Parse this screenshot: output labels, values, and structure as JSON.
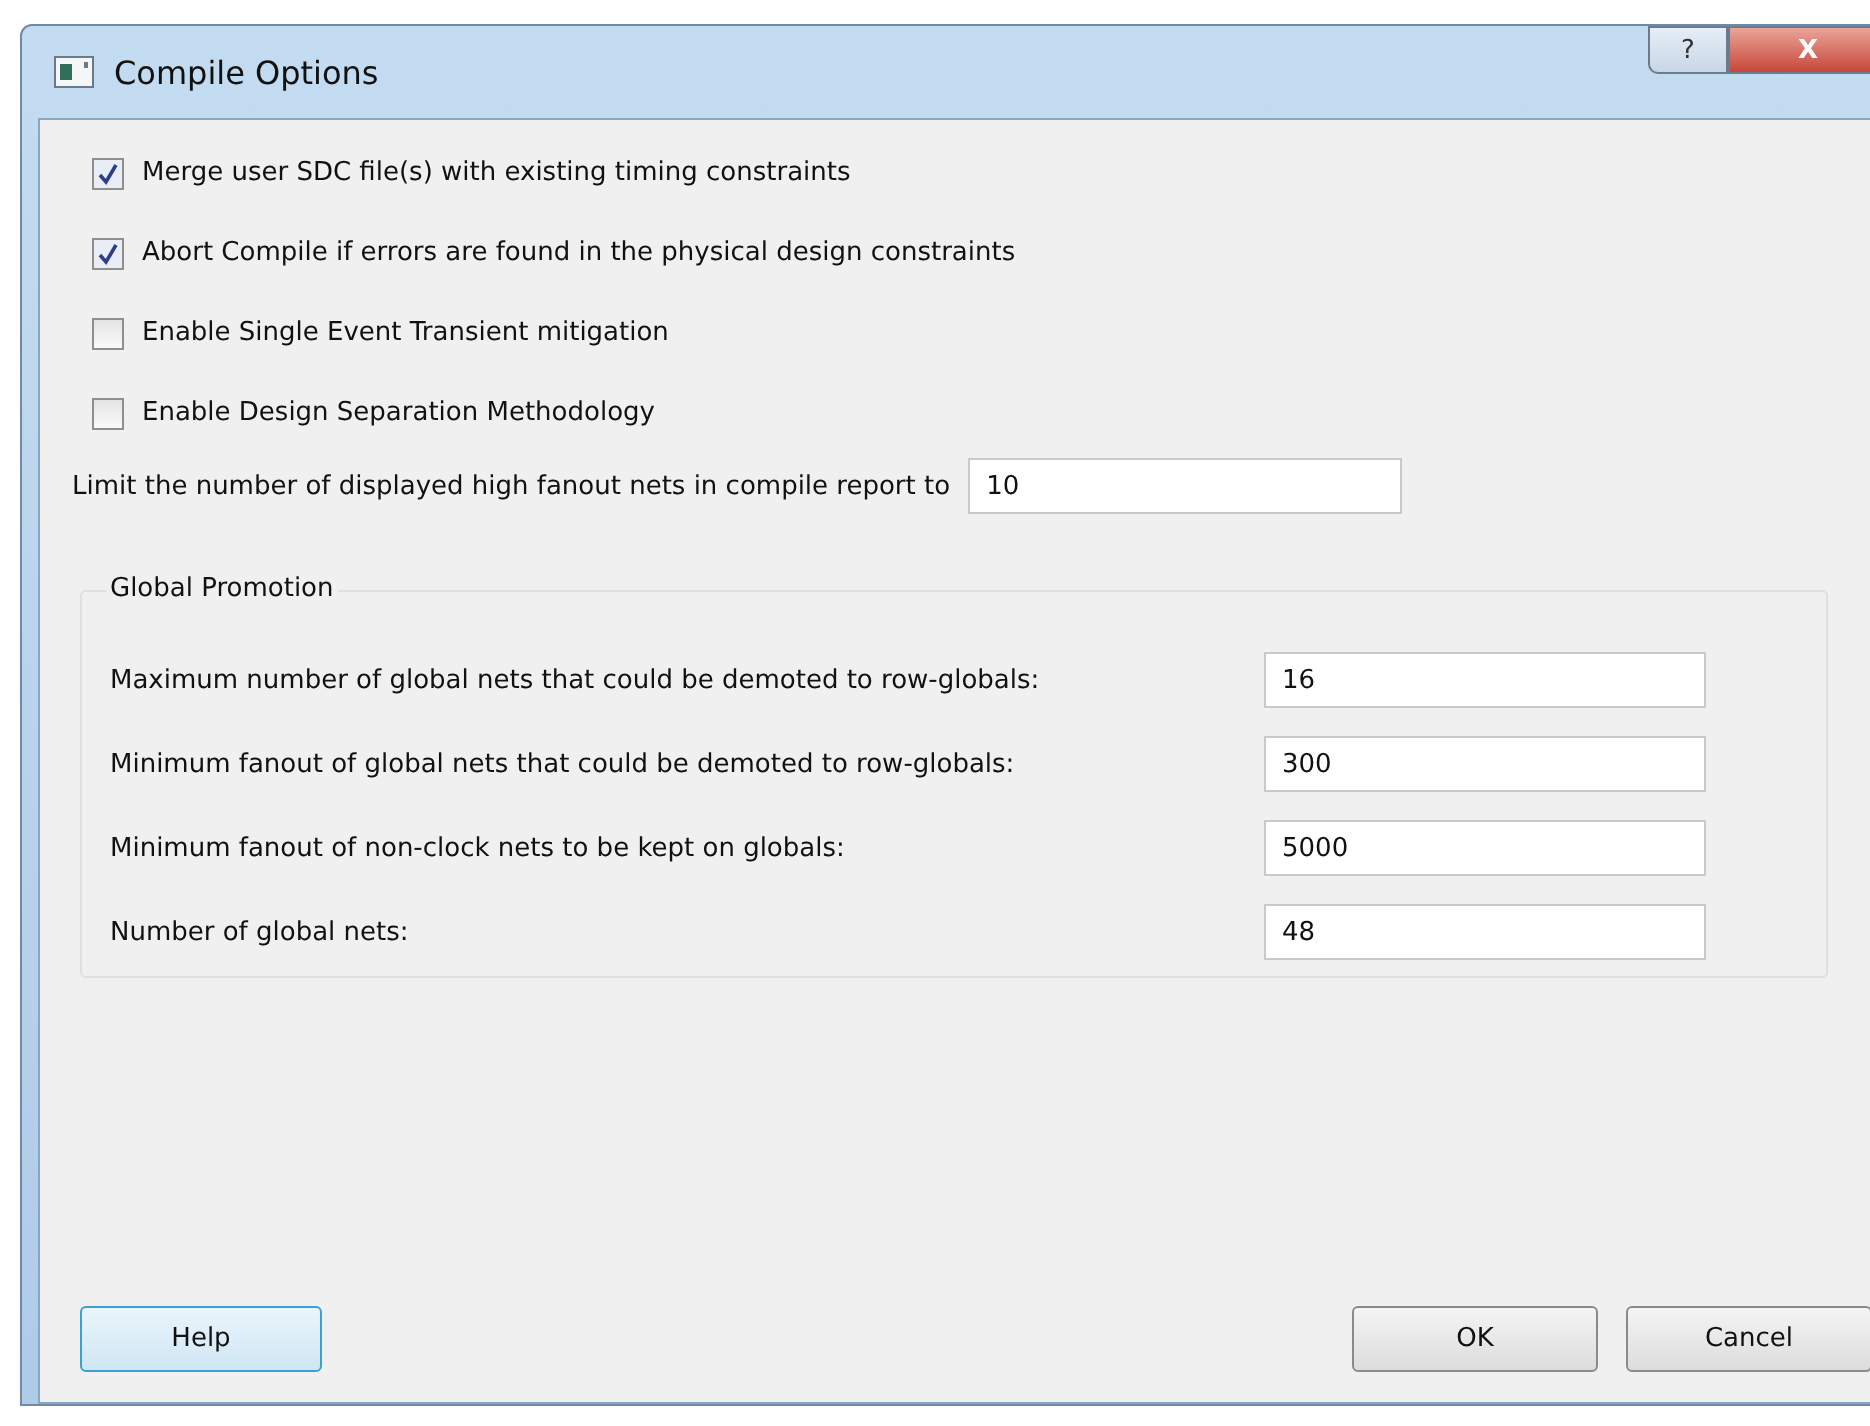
{
  "window": {
    "title": "Compile Options",
    "help_button": "?",
    "close_button": "X"
  },
  "options": [
    {
      "label": "Merge user SDC file(s) with existing timing constraints",
      "checked": true
    },
    {
      "label": "Abort Compile if errors are found in the physical design constraints",
      "checked": true
    },
    {
      "label": "Enable Single Event Transient mitigation",
      "checked": false
    },
    {
      "label": "Enable Design Separation Methodology",
      "checked": false
    }
  ],
  "limit": {
    "label": "Limit the number of displayed high fanout nets in compile report to",
    "value": "10"
  },
  "global_promotion": {
    "title": "Global Promotion",
    "fields": [
      {
        "label": "Maximum number of global nets that could be demoted to row-globals:",
        "value": "16"
      },
      {
        "label": "Minimum fanout of global nets that could be demoted to row-globals:",
        "value": "300"
      },
      {
        "label": "Minimum fanout of non-clock nets to be kept on globals:",
        "value": "5000"
      },
      {
        "label": "Number of global nets:",
        "value": "48"
      }
    ]
  },
  "buttons": {
    "help": "Help",
    "ok": "OK",
    "cancel": "Cancel"
  }
}
